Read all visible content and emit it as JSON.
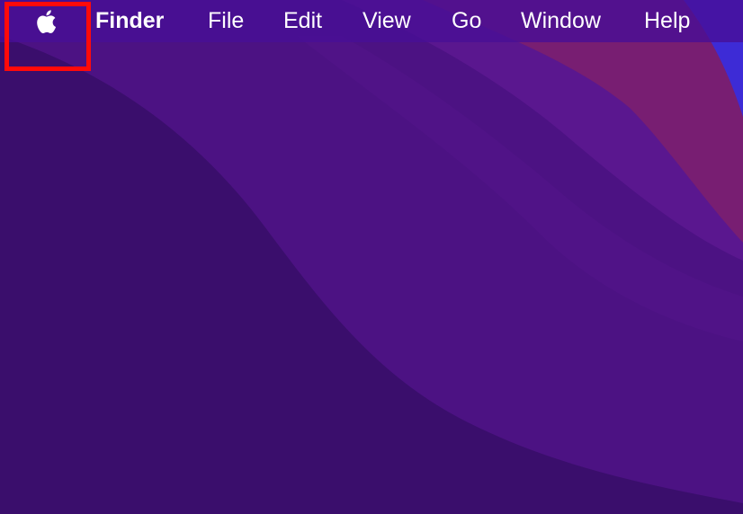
{
  "menubar": {
    "apple_menu_icon": "apple-logo",
    "items": [
      "Finder",
      "File",
      "Edit",
      "View",
      "Go",
      "Window",
      "Help"
    ]
  },
  "colors": {
    "menubar": "#480e96",
    "highlight": "#ff0a0a",
    "wallpaper_dark": "#3a0f6e",
    "wallpaper_mid": "#56148a",
    "wallpaper_pink": "#7a1f6e",
    "wallpaper_blue": "#3d2bd6"
  }
}
